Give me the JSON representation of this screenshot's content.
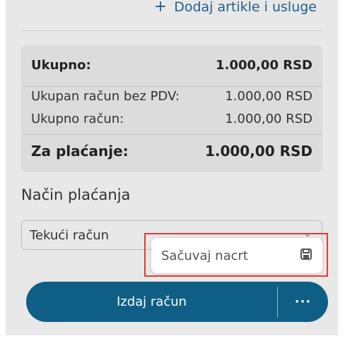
{
  "header": {
    "add_items_label": "Dodaj artikle i usluge",
    "add_icon": "plus-icon"
  },
  "summary": {
    "total_label": "Ukupno:",
    "total_value": "1.000,00 RSD",
    "without_vat_label": "Ukupan račun bez PDV:",
    "without_vat_value": "1.000,00 RSD",
    "invoice_total_label": "Ukupno račun:",
    "invoice_total_value": "1.000,00 RSD",
    "to_pay_label": "Za plaćanje:",
    "to_pay_value": "1.000,00 RSD"
  },
  "payment": {
    "title": "Način plaćanja",
    "selected": "Tekući račun"
  },
  "draft_menu": {
    "save_draft_label": "Sačuvaj nacrt",
    "icon": "save-icon"
  },
  "actions": {
    "issue_label": "Izdaj račun",
    "more_label": "···"
  }
}
